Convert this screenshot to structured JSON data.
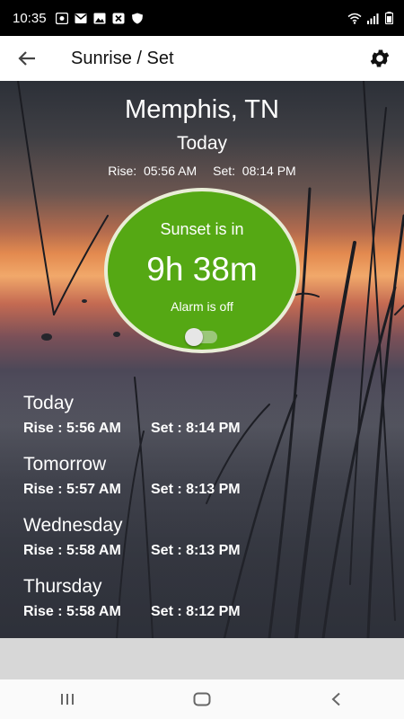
{
  "status_bar": {
    "time": "10:35"
  },
  "app_bar": {
    "title": "Sunrise / Set"
  },
  "location": {
    "city": "Memphis, TN",
    "day": "Today",
    "rise_label": "Rise:",
    "rise_time": "05:56 AM",
    "set_label": "Set:",
    "set_time": "08:14 PM"
  },
  "countdown": {
    "label": "Sunset is in",
    "value": "9h 38m",
    "alarm_status": "Alarm is off",
    "alarm_enabled": false
  },
  "forecast": [
    {
      "day": "Today",
      "rise": "Rise : 5:56 AM",
      "set": "Set : 8:14 PM"
    },
    {
      "day": "Tomorrow",
      "rise": "Rise : 5:57 AM",
      "set": "Set : 8:13 PM"
    },
    {
      "day": "Wednesday",
      "rise": "Rise : 5:58 AM",
      "set": "Set : 8:13 PM"
    },
    {
      "day": "Thursday",
      "rise": "Rise : 5:58 AM",
      "set": "Set : 8:12 PM"
    }
  ],
  "colors": {
    "accent_green": "#55a814",
    "status_bar": "#000000"
  },
  "icons": {
    "back": "arrow-back-icon",
    "settings": "gear-icon",
    "nav_recents": "recents-icon",
    "nav_home": "home-icon",
    "nav_back": "nav-back-icon"
  }
}
